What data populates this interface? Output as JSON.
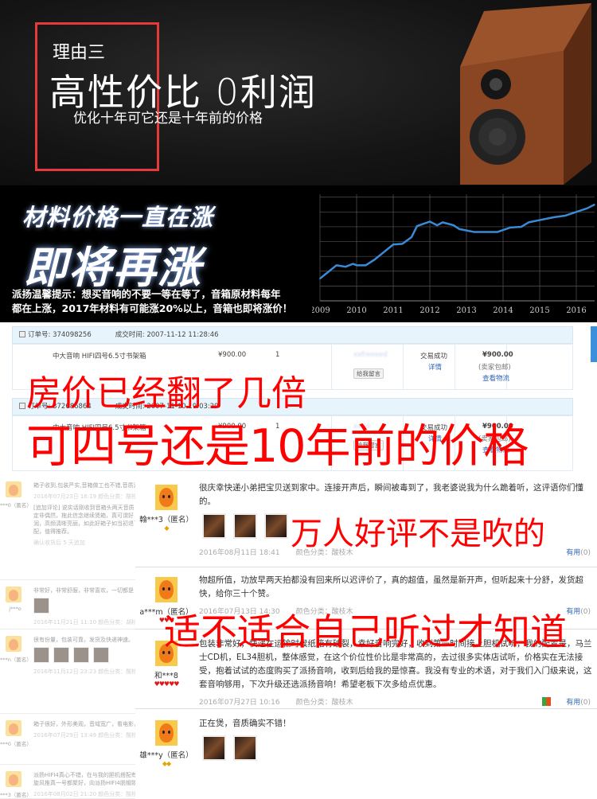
{
  "hero": {
    "reason_label": "理由三",
    "headline": "高性价比  0利润",
    "subline": "优化十年可它还是十年前的价格",
    "speaker_brand": "paiyang"
  },
  "price_band": {
    "title": "材料价格一直在涨",
    "headline": "即将再涨",
    "note_line1": "派扬温馨提示：想买音响的不要一等在等了，音箱原材料每年",
    "note_line2": "都在上涨，2017年材料有可能涨20%以上，音箱也即将涨价！"
  },
  "chart_data": {
    "type": "line",
    "title": "",
    "xlabel": "",
    "ylabel": "",
    "x_ticks": [
      "2009",
      "2010",
      "2011",
      "2012",
      "2013",
      "2014",
      "2015",
      "2016"
    ],
    "xlim": [
      2009,
      2016.5
    ],
    "ylim": [
      0,
      7.2
    ],
    "grid": true,
    "line_color": "#3b8ad6",
    "series": [
      {
        "x": [
          2009.0,
          2009.25,
          2009.45,
          2009.7,
          2009.9,
          2010.0,
          2010.25,
          2010.5,
          2010.75,
          2011.0,
          2011.25,
          2011.5,
          2011.65,
          2012.0,
          2012.2,
          2012.35,
          2012.65,
          2012.8,
          2013.2,
          2013.85,
          2014.2,
          2014.5,
          2014.7,
          2015.0,
          2015.4,
          2015.7,
          2016.0,
          2016.3,
          2016.5
        ],
        "y": [
          1.5,
          2.0,
          2.4,
          2.3,
          2.5,
          2.4,
          2.4,
          2.8,
          3.3,
          3.8,
          3.85,
          4.3,
          5.05,
          5.35,
          5.1,
          5.3,
          5.1,
          4.85,
          4.65,
          4.65,
          4.95,
          5.0,
          5.3,
          5.45,
          5.65,
          5.75,
          6.0,
          6.25,
          6.5
        ]
      }
    ]
  },
  "orders": [
    {
      "order_label": "订单号: 374098256",
      "time_label": "成交时间: 2007-11-12 11:28:46",
      "product": "中大音响 HIFI四号6.5寸书架箱",
      "price": "¥900.00",
      "qty": "1",
      "seller": "xxfreeeed",
      "message_btn": "给我留言",
      "status": "交易成功",
      "detail": "详情",
      "total": "¥900.00",
      "shipping": "(卖家包邮)",
      "logistics": "查看物流"
    },
    {
      "order_label": "订单号: 372686864",
      "time_label": "成交时间: 2007-11-10 19:03:29",
      "product": "中大音响 HIFI四号6.5寸书架箱",
      "price": "¥900.00",
      "qty": "1",
      "seller": "xxfre",
      "message_btn": "给我留言",
      "status": "交易成功",
      "detail": "详情",
      "total": "¥900.00",
      "shipping": "(卖家包邮)",
      "logistics": "查看物流"
    }
  ],
  "overlays": {
    "house_price": "房价已经翻了几倍",
    "same_price": "可四号还是10年前的价格",
    "reviews_real": "万人好评不是吹的",
    "listen_yourself": "适不适合自己听过才知道"
  },
  "left_reviews": [
    {
      "name": "***0（匿名）",
      "text": [
        "箱子收到,包装严实,音箱做工也不错,音质还"
      ],
      "meta": "2016年07月23日 16:19   颜色分类：酸枝木",
      "append": [
        "[追加评论] 说实话刚收到音箱头两天音质",
        "定非偶然，拖此信念继续煲箱，真可谓好",
        "润，高频清晰亮丽，如此好箱子如当初退了",
        "配，值得推荐。"
      ],
      "append_meta": "确认收货后 5 天追加"
    },
    {
      "name": "j***o",
      "text": [
        "非常好，非常舒服，非常喜欢，一切都是"
      ],
      "meta": "2016年11月21日 11:10   颜色分类：胡桃木"
    },
    {
      "name": "***n（匿名）",
      "text": [
        "很有份量，包装可靠，发货及快递神速。"
      ],
      "meta": "2016年11月12日 23:23   颜色分类：酸枝木"
    },
    {
      "name": "***0（匿名）",
      "text": [
        "箱子很好，外形美观，音域宽广，看电影，"
      ],
      "meta": "2016年07月29日 13:49   颜色分类：酸枝木"
    },
    {
      "name": "***3（匿名）",
      "text": [
        "派扬HIFI4真心不错，在与我的胆机搭配有",
        "旋风推真一号都聚好，向派扬HIFI4脱帽致"
      ],
      "meta": "2016年08月02日 21:20   颜色分类：酸枝木"
    }
  ],
  "reviews": [
    {
      "name": "翰***3（匿名）",
      "badge": "◆",
      "text": "很庆幸快递小弟把宝贝送到家中。连接开声后，瞬间被毒到了，我老婆说我为什么跪着听，这评语你们懂的。",
      "date": "2016年08月11日 18:41",
      "color": "颜色分类：酸枝木",
      "useful": "有用",
      "useful_count": "(0)"
    },
    {
      "name": "a***m（匿名）",
      "badge": "♥♥♥",
      "text": "物超所值，功放早两天拍都没有回来所以迟评价了，真的超值，虽然是新开声，但听起来十分舒，发货超快，给你三十个赞。",
      "date": "2016年07月13日 14:30",
      "color": "颜色分类：酸枝木",
      "useful": "有用",
      "useful_count": "(0)"
    },
    {
      "name": "和***8",
      "badge": "♥♥♥♥♥",
      "text": "包装非常好，快递在运输时候纸箱有破裂，幸好音响完好，收到第一时间接上胆机试听，我的配置是，马兰士CD机，EL34胆机，整体感觉，在这个价位性价比是非常高的，去过很多实体店试听，价格实在无法接受，抱着试试的态度购买了派扬音响，收到后给我的是惊喜。我没有专业的术语，对于我们入门级来说，这套音响够用，下次升级还选派扬音响！希望老板下次多给点优惠。",
      "date": "2016年07月27日 10:16",
      "color": "颜色分类：酸枝木",
      "useful": "有用",
      "useful_count": "(0)"
    },
    {
      "name": "雄***y（匿名）",
      "badge": "◆◆",
      "text": "正在煲，音质确实不错！"
    }
  ]
}
